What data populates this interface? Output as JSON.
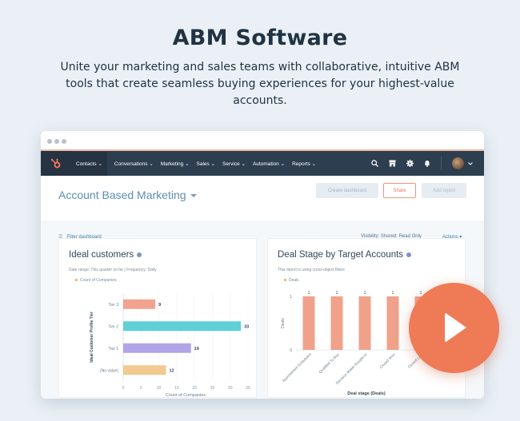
{
  "hero": {
    "title": "ABM Software",
    "subtitle": "Unite your marketing and sales teams with collaborative, intuitive ABM tools that create seamless buying experiences for your highest-value accounts."
  },
  "nav": {
    "items": [
      {
        "label": "Contacts ⌄"
      },
      {
        "label": "Conversations ⌄"
      },
      {
        "label": "Marketing ⌄"
      },
      {
        "label": "Sales ⌄"
      },
      {
        "label": "Service ⌄"
      },
      {
        "label": "Automation ⌄"
      },
      {
        "label": "Reports ⌄"
      }
    ],
    "icons": [
      "search-icon",
      "marketplace-icon",
      "gear-icon",
      "bell-icon",
      "avatar",
      "chevron-down-icon"
    ]
  },
  "dashboard": {
    "title": "Account Based Marketing",
    "buttons": {
      "create": "Create dashboard",
      "share": "Share",
      "add": "Add report"
    },
    "filter_label": "Filter dashboard",
    "visibility": "Visibility:  Shared: Read Only",
    "actions": "Actions ▾"
  },
  "colors": {
    "accent": "#ef7a56",
    "nav_bg": "#2d3e50",
    "link": "#3b7fa7"
  },
  "chart_data": [
    {
      "type": "bar",
      "orientation": "horizontal",
      "title": "Ideal customers",
      "meta": "Date range: This quarter so far  |  Frequency: Daily",
      "legend": [
        "Count of Companies"
      ],
      "categories": [
        "Tier 3",
        "Tier 2",
        "Tier 1",
        "(No value)"
      ],
      "values": [
        9,
        33,
        19,
        12
      ],
      "colors": [
        "#f2a38f",
        "#5ed0d6",
        "#b3a4e8",
        "#f2c98e"
      ],
      "xlabel": "Count of Companies",
      "ylabel": "Ideal Customer Profile Tier",
      "xticks": [
        "0",
        "5",
        "10",
        "15",
        "20",
        "25",
        "30",
        "35"
      ],
      "xlim": [
        0,
        35
      ],
      "grid": true
    },
    {
      "type": "bar",
      "orientation": "vertical",
      "title": "Deal Stage by Target Accounts",
      "meta": "This report is using cross-object filters",
      "legend": [
        "Deals"
      ],
      "categories": [
        "Appointment Scheduled",
        "Qualified To Buy",
        "Decision Maker Bought-In",
        "Closed Won",
        "Closed Lost"
      ],
      "values": [
        1,
        1,
        1,
        1,
        1
      ],
      "color": "#f0a18a",
      "xlabel": "Deal stage (Deals)",
      "ylabel": "Deals",
      "yticks": [
        "0",
        "1"
      ],
      "ylim": [
        0,
        1
      ]
    }
  ]
}
